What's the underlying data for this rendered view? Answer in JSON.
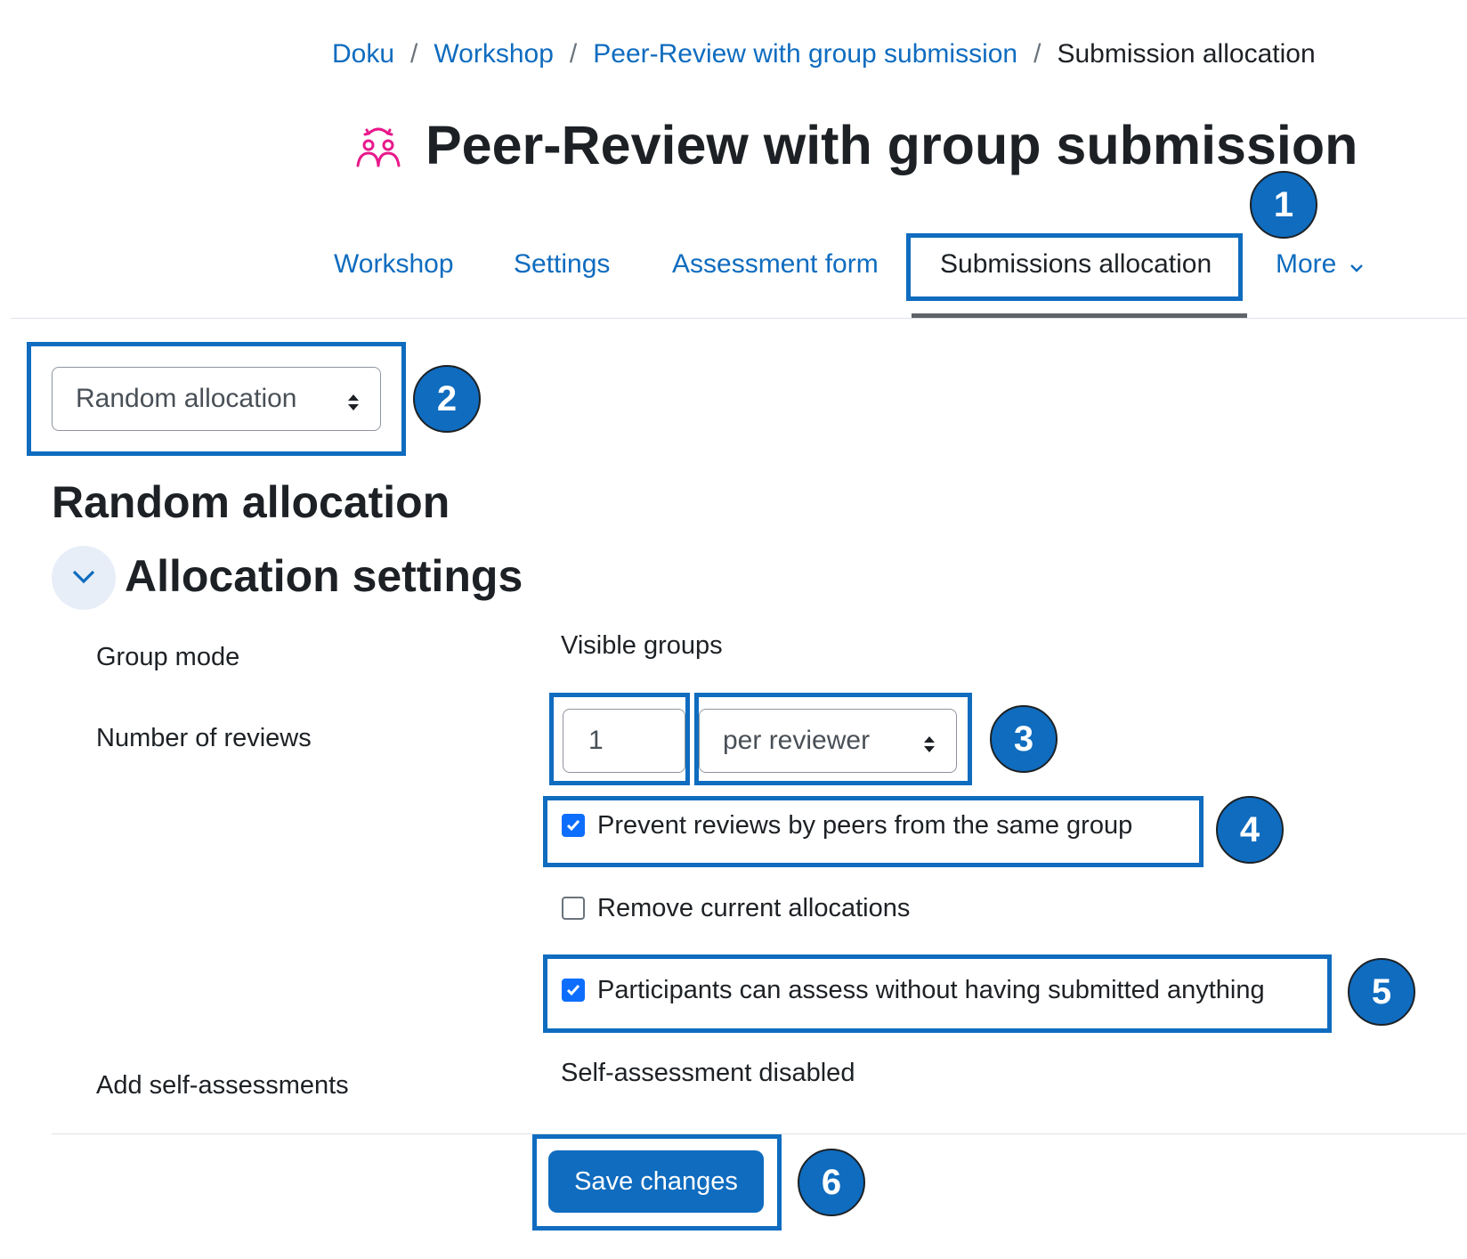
{
  "breadcrumb": {
    "items": [
      "Doku",
      "Workshop",
      "Peer-Review with group submission"
    ],
    "separator": "/",
    "current": "Submission allocation"
  },
  "page": {
    "title": "Peer-Review with group submission",
    "icon": "workshop-icon",
    "icon_color": "#e8198b"
  },
  "tabs": {
    "items": [
      "Workshop",
      "Settings",
      "Assessment form",
      "Submissions allocation",
      "More"
    ],
    "active": "Submissions allocation"
  },
  "allocation_method": {
    "selected": "Random allocation"
  },
  "section": {
    "heading": "Random allocation",
    "subheading": "Allocation settings"
  },
  "form": {
    "group_mode_label": "Group mode",
    "group_mode_value": "Visible groups",
    "num_reviews_label": "Number of reviews",
    "num_reviews_value": "1",
    "num_reviews_mode": "per reviewer",
    "prevent_same_group_label": "Prevent reviews by peers from the same group",
    "prevent_same_group_checked": true,
    "remove_current_label": "Remove current allocations",
    "remove_current_checked": false,
    "assess_without_submission_label": "Participants can assess without having submitted anything",
    "assess_without_submission_checked": true,
    "self_assessment_label": "Add self-assessments",
    "self_assessment_value": "Self-assessment disabled",
    "save_label": "Save changes"
  },
  "annotations": [
    "1",
    "2",
    "3",
    "4",
    "5",
    "6"
  ],
  "colors": {
    "accent": "#0f6cbf",
    "checkbox": "#0d6efd",
    "text": "#1d2125"
  }
}
